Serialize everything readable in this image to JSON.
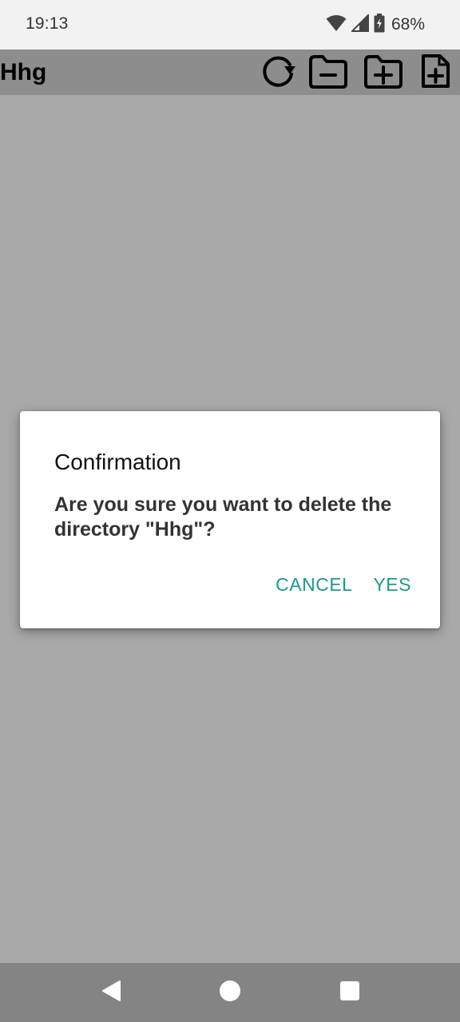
{
  "status_bar": {
    "time": "19:13",
    "battery_percent": "68%",
    "icons": [
      "wifi-icon",
      "cell-signal-icon",
      "battery-charging-icon"
    ]
  },
  "toolbar": {
    "title": "Hhg",
    "icons": [
      "refresh-icon",
      "folder-remove-icon",
      "folder-add-icon",
      "file-add-icon"
    ]
  },
  "dialog": {
    "title": "Confirmation",
    "message": "Are you sure you want to delete the directory \"Hhg\"?",
    "cancel_label": "CANCEL",
    "yes_label": "YES",
    "accent_color": "#1b9a8a"
  },
  "nav_bar": {
    "icons": [
      "back-icon",
      "home-icon",
      "recents-icon"
    ]
  }
}
